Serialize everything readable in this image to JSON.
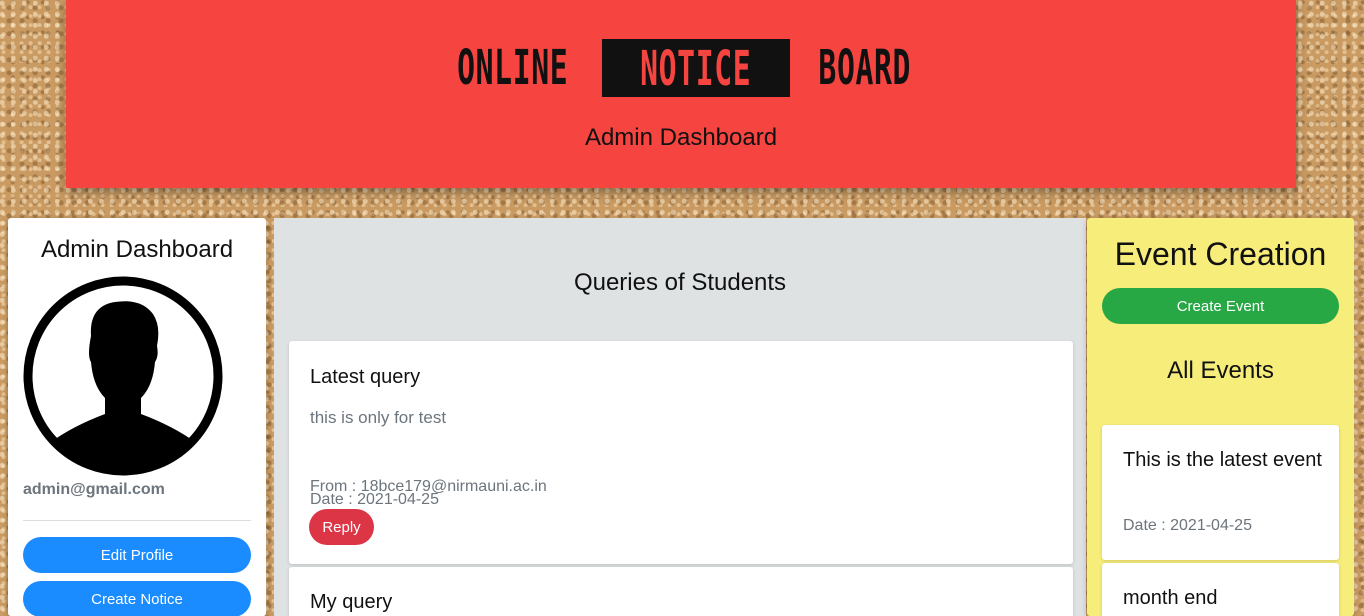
{
  "header": {
    "logo_word1": "ONLINE",
    "logo_word2": "NOTICE",
    "logo_word3": "BOARD",
    "subtitle": "Admin Dashboard"
  },
  "sidebar": {
    "title": "Admin Dashboard",
    "email": "admin@gmail.com",
    "edit_profile_label": "Edit Profile",
    "create_notice_label": "Create Notice"
  },
  "queries": {
    "title": "Queries of Students",
    "items": [
      {
        "title": "Latest query",
        "body": "this is only for test",
        "from": "From : 18bce179@nirmauni.ac.in",
        "date": "Date : 2021-04-25",
        "reply_label": "Reply"
      },
      {
        "title": "My query"
      }
    ]
  },
  "events": {
    "title": "Event Creation",
    "create_label": "Create Event",
    "list_title": "All Events",
    "items": [
      {
        "title": "This is the latest event",
        "date": "Date : 2021-04-25"
      },
      {
        "title": "month end"
      }
    ]
  },
  "colors": {
    "header_bg": "#f64440",
    "primary": "#1a8cff",
    "danger": "#dc3545",
    "success": "#28a745",
    "events_bg": "#f7ed7a",
    "queries_bg": "#dee2e3"
  }
}
